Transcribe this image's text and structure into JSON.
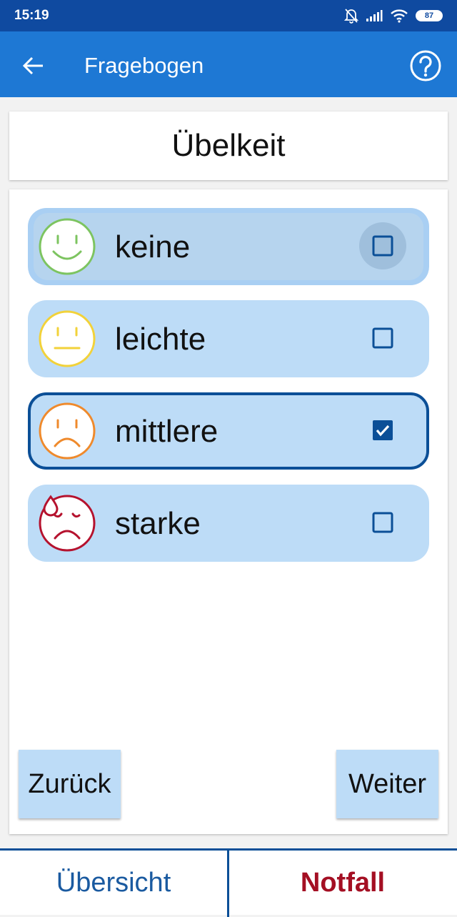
{
  "status_bar": {
    "time": "15:19",
    "battery": "87",
    "icons": [
      "bell-off-icon",
      "signal-icon",
      "wifi-icon",
      "battery-icon"
    ]
  },
  "app_bar": {
    "title": "Fragebogen",
    "back_icon": "arrow-left-icon",
    "help_icon": "help-circle-icon"
  },
  "question": {
    "title": "Übelkeit"
  },
  "options": [
    {
      "label": "keine",
      "face": "smile-face-icon",
      "color": "#7dc460",
      "checked": false
    },
    {
      "label": "leichte",
      "face": "neutral-face-icon",
      "color": "#f2d23a",
      "checked": false
    },
    {
      "label": "mittlere",
      "face": "frown-face-icon",
      "color": "#ef8a2c",
      "checked": true
    },
    {
      "label": "starke",
      "face": "sweat-frown-face-icon",
      "color": "#b5122e",
      "checked": false
    }
  ],
  "navigation": {
    "back_label": "Zurück",
    "next_label": "Weiter"
  },
  "bottom_bar": {
    "overview_label": "Übersicht",
    "emergency_label": "Notfall"
  },
  "colors": {
    "status_bar": "#0f4aa0",
    "app_bar": "#1e78d4",
    "option_background": "#bddcf7",
    "selected_border": "#0b4f97",
    "emergency": "#a40f23",
    "overview": "#1a5aa0"
  }
}
